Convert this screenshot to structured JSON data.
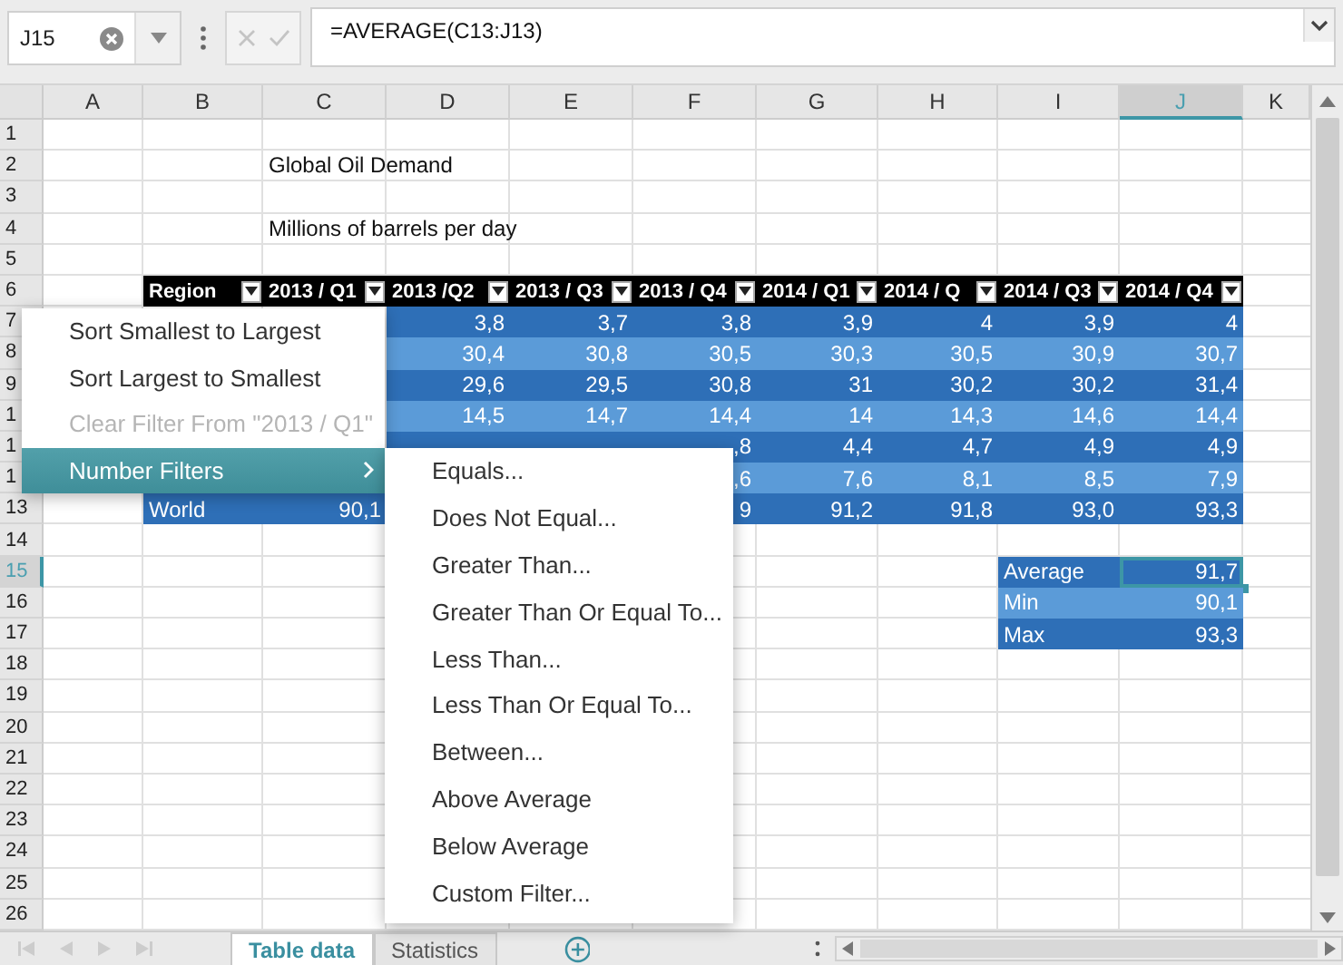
{
  "name_box": {
    "value": "J15"
  },
  "formula_bar": {
    "value": "=AVERAGE(C13:J13)"
  },
  "columns": [
    {
      "label": "A",
      "selected": false
    },
    {
      "label": "B",
      "selected": false
    },
    {
      "label": "C",
      "selected": false
    },
    {
      "label": "D",
      "selected": false
    },
    {
      "label": "E",
      "selected": false
    },
    {
      "label": "F",
      "selected": false
    },
    {
      "label": "G",
      "selected": false
    },
    {
      "label": "H",
      "selected": false
    },
    {
      "label": "I",
      "selected": false
    },
    {
      "label": "J",
      "selected": true
    },
    {
      "label": "K",
      "selected": false
    }
  ],
  "rows": [
    {
      "label": "1",
      "selected": false
    },
    {
      "label": "2",
      "selected": false,
      "cells": [
        null,
        null,
        {
          "text": "Global Oil Demand",
          "kind": "title"
        }
      ]
    },
    {
      "label": "3",
      "selected": false
    },
    {
      "label": "4",
      "selected": false,
      "cells": [
        null,
        null,
        {
          "text": "Millions of barrels per day",
          "kind": "title"
        }
      ]
    },
    {
      "label": "5",
      "selected": false
    },
    {
      "label": "6",
      "selected": false,
      "cells": [
        null,
        {
          "text": "Region",
          "kind": "header"
        },
        {
          "text": "2013 / Q1",
          "kind": "header"
        },
        {
          "text": "2013 /Q2",
          "kind": "header"
        },
        {
          "text": "2013 / Q3",
          "kind": "header"
        },
        {
          "text": "2013 / Q4",
          "kind": "header"
        },
        {
          "text": "2014 / Q1",
          "kind": "header"
        },
        {
          "text": "2014 / Q",
          "kind": "header"
        },
        {
          "text": "2014 / Q3",
          "kind": "header"
        },
        {
          "text": "2014 / Q4",
          "kind": "header"
        }
      ]
    },
    {
      "label": "7",
      "selected": false,
      "cells": [
        null,
        null,
        null,
        {
          "text": "3,8",
          "kind": "dark",
          "numeric": true,
          "selected": false
        },
        {
          "text": "3,7",
          "kind": "dark",
          "numeric": true,
          "selected": false
        },
        {
          "text": "3,8",
          "kind": "dark",
          "numeric": true,
          "selected": false
        },
        {
          "text": "3,9",
          "kind": "dark",
          "numeric": true,
          "selected": false
        },
        {
          "text": "4",
          "kind": "dark",
          "numeric": true,
          "selected": false
        },
        {
          "text": "3,9",
          "kind": "dark",
          "numeric": true,
          "selected": false
        },
        {
          "text": "4",
          "kind": "dark",
          "numeric": true,
          "selected": false
        }
      ]
    },
    {
      "label": "8",
      "selected": false,
      "cells": [
        null,
        null,
        null,
        {
          "text": "30,4",
          "kind": "light",
          "numeric": true,
          "selected": false
        },
        {
          "text": "30,8",
          "kind": "light",
          "numeric": true,
          "selected": false
        },
        {
          "text": "30,5",
          "kind": "light",
          "numeric": true,
          "selected": false
        },
        {
          "text": "30,3",
          "kind": "light",
          "numeric": true,
          "selected": false
        },
        {
          "text": "30,5",
          "kind": "light",
          "numeric": true,
          "selected": false
        },
        {
          "text": "30,9",
          "kind": "light",
          "numeric": true,
          "selected": false
        },
        {
          "text": "30,7",
          "kind": "light",
          "numeric": true,
          "selected": false
        }
      ]
    },
    {
      "label": "9",
      "selected": false,
      "cells": [
        null,
        null,
        null,
        {
          "text": "29,6",
          "kind": "dark",
          "numeric": true,
          "selected": false
        },
        {
          "text": "29,5",
          "kind": "dark",
          "numeric": true,
          "selected": false
        },
        {
          "text": "30,8",
          "kind": "dark",
          "numeric": true,
          "selected": false
        },
        {
          "text": "31",
          "kind": "dark",
          "numeric": true,
          "selected": false
        },
        {
          "text": "30,2",
          "kind": "dark",
          "numeric": true,
          "selected": false
        },
        {
          "text": "30,2",
          "kind": "dark",
          "numeric": true,
          "selected": false
        },
        {
          "text": "31,4",
          "kind": "dark",
          "numeric": true,
          "selected": false
        }
      ]
    },
    {
      "label": "1",
      "selected": false,
      "cells": [
        null,
        null,
        null,
        {
          "text": "14,5",
          "kind": "light",
          "numeric": true,
          "selected": false
        },
        {
          "text": "14,7",
          "kind": "light",
          "numeric": true,
          "selected": false
        },
        {
          "text": "14,4",
          "kind": "light",
          "numeric": true,
          "selected": false
        },
        {
          "text": "14",
          "kind": "light",
          "numeric": true,
          "selected": false
        },
        {
          "text": "14,3",
          "kind": "light",
          "numeric": true,
          "selected": false
        },
        {
          "text": "14,6",
          "kind": "light",
          "numeric": true,
          "selected": false
        },
        {
          "text": "14,4",
          "kind": "light",
          "numeric": true,
          "selected": false
        }
      ]
    },
    {
      "label": "1",
      "selected": false,
      "cells": [
        null,
        null,
        null,
        {
          "kind": "dark",
          "selected": false
        },
        {
          "kind": "dark",
          "selected": false
        },
        {
          "text": ",8",
          "kind": "dark",
          "numeric": true,
          "selected": false
        },
        {
          "text": "4,4",
          "kind": "dark",
          "numeric": true,
          "selected": false
        },
        {
          "text": "4,7",
          "kind": "dark",
          "numeric": true,
          "selected": false
        },
        {
          "text": "4,9",
          "kind": "dark",
          "numeric": true,
          "selected": false
        },
        {
          "text": "4,9",
          "kind": "dark",
          "numeric": true,
          "selected": false
        }
      ]
    },
    {
      "label": "1",
      "selected": false,
      "cells": [
        null,
        null,
        null,
        null,
        null,
        {
          "text": ",6",
          "kind": "light",
          "numeric": true,
          "selected": false
        },
        {
          "text": "7,6",
          "kind": "light",
          "numeric": true,
          "selected": false
        },
        {
          "text": "8,1",
          "kind": "light",
          "numeric": true,
          "selected": false
        },
        {
          "text": "8,5",
          "kind": "light",
          "numeric": true,
          "selected": false
        },
        {
          "text": "7,9",
          "kind": "light",
          "numeric": true,
          "selected": false
        }
      ]
    },
    {
      "label": "13",
      "selected": false,
      "cells": [
        null,
        {
          "text": "World",
          "kind": "dark",
          "numeric": false,
          "selected": false
        },
        {
          "text": "90,1",
          "kind": "dark",
          "numeric": true,
          "selected": false
        },
        null,
        null,
        {
          "text": "9",
          "kind": "dark",
          "numeric": true,
          "selected": false
        },
        {
          "text": "91,2",
          "kind": "dark",
          "numeric": true,
          "selected": false
        },
        {
          "text": "91,8",
          "kind": "dark",
          "numeric": true,
          "selected": false
        },
        {
          "text": "93,0",
          "kind": "dark",
          "numeric": true,
          "selected": false
        },
        {
          "text": "93,3",
          "kind": "dark",
          "numeric": true,
          "selected": false
        }
      ]
    },
    {
      "label": "14",
      "selected": false
    },
    {
      "label": "15",
      "selected": true,
      "cells": [
        null,
        null,
        null,
        null,
        null,
        null,
        null,
        null,
        {
          "text": "Average",
          "kind": "dark",
          "numeric": false,
          "selected": false
        },
        {
          "text": "91,7",
          "kind": "dark",
          "numeric": true,
          "selected": true
        }
      ]
    },
    {
      "label": "16",
      "selected": false,
      "cells": [
        null,
        null,
        null,
        null,
        null,
        null,
        null,
        null,
        {
          "text": "Min",
          "kind": "light",
          "numeric": false,
          "selected": false
        },
        {
          "text": "90,1",
          "kind": "light",
          "numeric": true,
          "selected": false
        }
      ]
    },
    {
      "label": "17",
      "selected": false,
      "cells": [
        null,
        null,
        null,
        null,
        null,
        null,
        null,
        null,
        {
          "text": "Max",
          "kind": "dark",
          "numeric": false,
          "selected": false
        },
        {
          "text": "93,3",
          "kind": "dark",
          "numeric": true,
          "selected": false
        }
      ]
    },
    {
      "label": "18",
      "selected": false
    },
    {
      "label": "19",
      "selected": false
    },
    {
      "label": "20",
      "selected": false
    },
    {
      "label": "21",
      "selected": false
    },
    {
      "label": "22",
      "selected": false
    },
    {
      "label": "23",
      "selected": false
    },
    {
      "label": "24",
      "selected": false
    },
    {
      "label": "25",
      "selected": false
    },
    {
      "label": "26",
      "selected": false
    }
  ],
  "filter_menu": {
    "items": [
      {
        "label": "Sort Smallest to Largest",
        "disabled": false,
        "selected": false,
        "submenu": false
      },
      {
        "label": "Sort Largest to Smallest",
        "disabled": false,
        "selected": false,
        "submenu": false
      },
      {
        "label": "Clear Filter From \"2013 / Q1\"",
        "disabled": true,
        "selected": false,
        "submenu": false
      },
      {
        "label": "Number Filters",
        "disabled": false,
        "selected": true,
        "submenu": true
      }
    ]
  },
  "number_filters_menu": {
    "items": [
      {
        "label": "Equals..."
      },
      {
        "label": "Does Not Equal..."
      },
      {
        "label": "Greater Than..."
      },
      {
        "label": "Greater Than Or Equal To..."
      },
      {
        "label": "Less Than..."
      },
      {
        "label": "Less Than Or Equal To..."
      },
      {
        "label": "Between..."
      },
      {
        "label": "Above Average"
      },
      {
        "label": "Below Average"
      },
      {
        "label": "Custom Filter..."
      }
    ]
  },
  "sheet_tabs": [
    {
      "label": "Table data",
      "selected": true
    },
    {
      "label": "Statistics",
      "selected": false
    }
  ]
}
